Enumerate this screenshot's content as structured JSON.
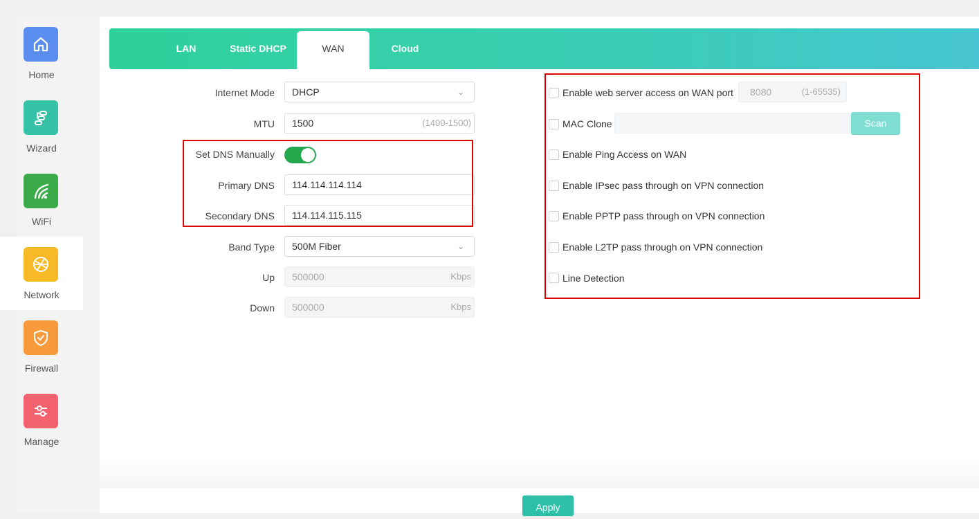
{
  "sidebar": {
    "items": [
      {
        "label": "Home",
        "icon": "home-icon",
        "color": "#5b8def"
      },
      {
        "label": "Wizard",
        "icon": "wizard-icon",
        "color": "#35c2a6"
      },
      {
        "label": "WiFi",
        "icon": "wifi-icon",
        "color": "#3aab48"
      },
      {
        "label": "Network",
        "icon": "network-icon",
        "color": "#f7b928"
      },
      {
        "label": "Firewall",
        "icon": "shield-icon",
        "color": "#f79a3b"
      },
      {
        "label": "Manage",
        "icon": "sliders-icon",
        "color": "#f4626f"
      }
    ],
    "active": "Network"
  },
  "tabs": [
    {
      "label": "LAN"
    },
    {
      "label": "Static DHCP"
    },
    {
      "label": "WAN"
    },
    {
      "label": "Cloud"
    }
  ],
  "active_tab": "WAN",
  "form": {
    "internet_mode": {
      "label": "Internet Mode",
      "value": "DHCP"
    },
    "mtu": {
      "label": "MTU",
      "value": "1500",
      "hint": "(1400-1500)"
    },
    "set_dns": {
      "label": "Set DNS Manually",
      "enabled": true
    },
    "primary_dns": {
      "label": "Primary DNS",
      "value": "114.114.114.114"
    },
    "secondary_dns": {
      "label": "Secondary DNS",
      "value": "114.114.115.115"
    },
    "band_type": {
      "label": "Band Type",
      "value": "500M Fiber"
    },
    "up": {
      "label": "Up",
      "value": "500000",
      "unit": "Kbps"
    },
    "down": {
      "label": "Down",
      "value": "500000",
      "unit": "Kbps"
    }
  },
  "options": {
    "web_server": {
      "label": "Enable web server access on WAN port",
      "port": "8080",
      "range": "(1-65535)",
      "checked": false
    },
    "mac_clone": {
      "label": "MAC Clone",
      "value": "",
      "button": "Scan",
      "checked": false
    },
    "ping": {
      "label": "Enable Ping Access on WAN",
      "checked": false
    },
    "ipsec": {
      "label": "Enable IPsec pass through on VPN connection",
      "checked": false
    },
    "pptp": {
      "label": "Enable PPTP pass through on VPN connection",
      "checked": false
    },
    "l2tp": {
      "label": "Enable L2TP pass through on VPN connection",
      "checked": false
    },
    "line_detection": {
      "label": "Line Detection",
      "checked": false
    }
  },
  "apply_label": "Apply",
  "colors": {
    "accent": "#2dbfa8",
    "toggle_on": "#26a64d",
    "highlight": "#e00000"
  }
}
